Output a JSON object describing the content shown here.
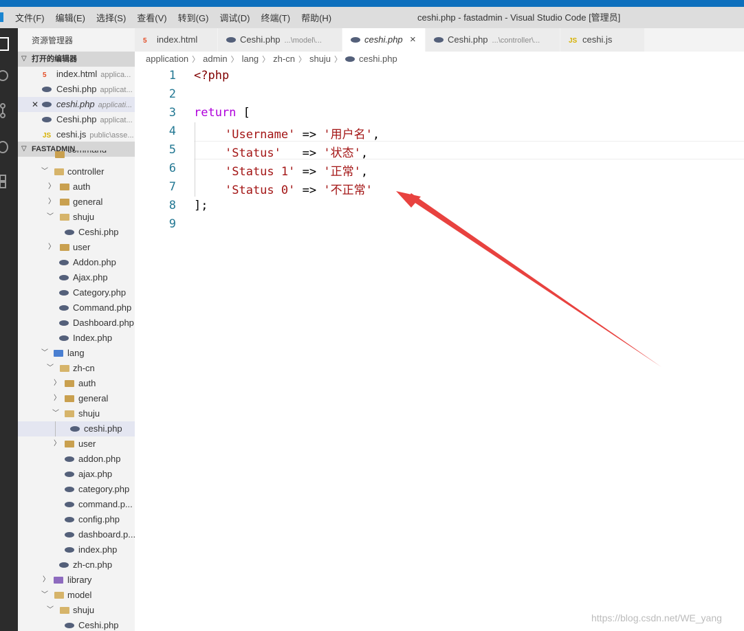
{
  "menu": [
    "文件(F)",
    "编辑(E)",
    "选择(S)",
    "查看(V)",
    "转到(G)",
    "调试(D)",
    "终端(T)",
    "帮助(H)"
  ],
  "window_title": "ceshi.php - fastadmin - Visual Studio Code [管理员]",
  "explorer_title": "资源管理器",
  "open_editors": {
    "header": "打开的编辑器",
    "items": [
      {
        "name": "index.html",
        "desc": "applica...",
        "icon": "html5-icon"
      },
      {
        "name": "Ceshi.php",
        "desc": "applicat...",
        "icon": "php-icon"
      },
      {
        "name": "ceshi.php",
        "desc": "applicati...",
        "icon": "php-icon"
      },
      {
        "name": "Ceshi.php",
        "desc": "applicat...",
        "icon": "php-icon"
      },
      {
        "name": "ceshi.js",
        "desc": "public\\asse...",
        "icon": "js-icon"
      }
    ]
  },
  "project": {
    "header": "FASTADMIN",
    "tree": [
      "command",
      "controller",
      "auth",
      "general",
      "shuju",
      "Ceshi.php",
      "user",
      "Addon.php",
      "Ajax.php",
      "Category.php",
      "Command.php",
      "Dashboard.php",
      "Index.php",
      "lang",
      "zh-cn",
      "auth",
      "general",
      "shuju",
      "ceshi.php",
      "user",
      "addon.php",
      "ajax.php",
      "category.php",
      "command.p...",
      "config.php",
      "dashboard.p...",
      "index.php",
      "zh-cn.php",
      "library",
      "model",
      "shuju",
      "Ceshi.php"
    ]
  },
  "tabs": [
    {
      "name": "index.html",
      "desc": "",
      "icon": "html5-icon"
    },
    {
      "name": "Ceshi.php",
      "desc": "...\\model\\...",
      "icon": "php-icon"
    },
    {
      "name": "ceshi.php",
      "desc": "",
      "icon": "php-icon",
      "close": "×"
    },
    {
      "name": "Ceshi.php",
      "desc": "...\\controller\\...",
      "icon": "php-icon"
    },
    {
      "name": "ceshi.js",
      "desc": "",
      "icon": "js-icon"
    }
  ],
  "breadcrumb": [
    "application",
    "admin",
    "lang",
    "zh-cn",
    "shuju",
    "ceshi.php"
  ],
  "code": {
    "line_numbers": [
      "1",
      "2",
      "3",
      "4",
      "5",
      "6",
      "7",
      "8",
      "9"
    ],
    "php_open": "<?php",
    "return_kw": "return",
    "open_bracket": " [",
    "entries": [
      {
        "key": "'Username'",
        "pad": " ",
        "arrow": "=>",
        "value": "'用户名'",
        "comma": ","
      },
      {
        "key": "'Status'",
        "pad": "   ",
        "arrow": "=>",
        "value": "'状态'",
        "comma": ","
      },
      {
        "key": "'Status 1'",
        "pad": " ",
        "arrow": "=>",
        "value": "'正常'",
        "comma": ","
      },
      {
        "key": "'Status 0'",
        "pad": " ",
        "arrow": "=>",
        "value": "'不正常'",
        "comma": ""
      }
    ],
    "close": "];"
  },
  "watermark": "https://blog.csdn.net/WE_yang",
  "colors": {
    "keyword": "#af00db",
    "string": "#a31515",
    "line_number": "#237893",
    "arrow": "#e8423f"
  }
}
